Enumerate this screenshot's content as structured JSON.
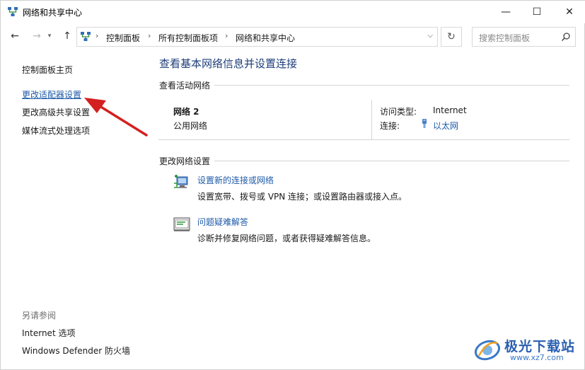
{
  "window": {
    "title": "网络和共享中心",
    "minimize_glyph": "—",
    "maximize_glyph": "☐",
    "close_glyph": "✕"
  },
  "nav": {
    "back_glyph": "←",
    "forward_glyph": "→",
    "history_glyph": "▾",
    "up_glyph": "↑",
    "breadcrumbs": [
      "控制面板",
      "所有控制面板项",
      "网络和共享中心"
    ],
    "crumb_separator": "›",
    "dropdown_glyph": "⌵",
    "refresh_glyph": "↻",
    "search_placeholder": "搜索控制面板"
  },
  "sidebar": {
    "items": [
      {
        "label": "控制面板主页",
        "active": false
      },
      {
        "label": "更改适配器设置",
        "active": true
      },
      {
        "label": "更改高级共享设置",
        "active": false
      },
      {
        "label": "媒体流式处理选项",
        "active": false
      }
    ],
    "see_also_title": "另请参阅",
    "see_also": [
      "Internet 选项",
      "Windows Defender 防火墙"
    ]
  },
  "main": {
    "title": "查看基本网络信息并设置连接",
    "active_networks_heading": "查看活动网络",
    "network": {
      "name": "网络 2",
      "category": "公用网络",
      "access_type_label": "访问类型:",
      "access_type_value": "Internet",
      "connection_label": "连接:",
      "connection_value": "以太网"
    },
    "change_settings_heading": "更改网络设置",
    "tasks": [
      {
        "link": "设置新的连接或网络",
        "desc": "设置宽带、拨号或 VPN 连接；或设置路由器或接入点。",
        "icon": "new-connection-icon"
      },
      {
        "link": "问题疑难解答",
        "desc": "诊断并修复网络问题，或者获得疑难解答信息。",
        "icon": "troubleshoot-icon"
      }
    ]
  },
  "watermark": {
    "name": "极光下载站",
    "url": "www.xz7.com"
  },
  "colors": {
    "link": "#1e5aa8",
    "title": "#1e3e7a",
    "annotation_arrow": "#d42020"
  }
}
